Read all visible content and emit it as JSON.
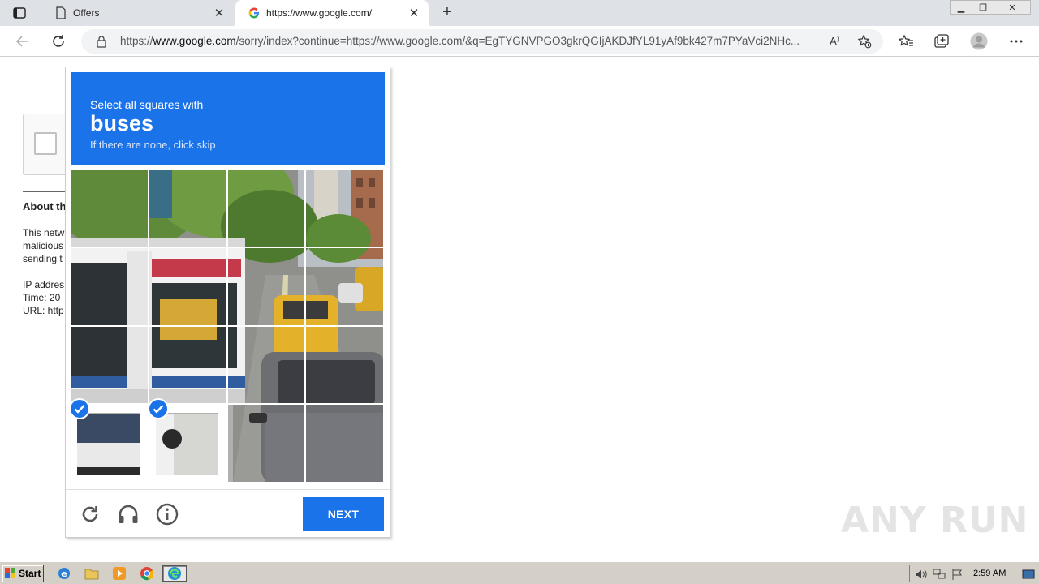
{
  "browser": {
    "tabs": [
      {
        "label": "Offers",
        "icon": "page-icon",
        "active": false
      },
      {
        "label": "https://www.google.com/",
        "icon": "google-icon",
        "active": true
      }
    ],
    "address": {
      "prefix": "https://",
      "host": "www.google.com",
      "path": "/sorry/index?continue=https://www.google.com/&q=EgTYGNVPGO3gkrQGIjAKDJfYL91yAf9bk427m7PYaVci2NHc..."
    }
  },
  "page": {
    "about_heading": "About th",
    "about_lines": [
      "This netw",
      "malicious",
      "sending t"
    ],
    "info_lines": [
      "IP addres",
      "Time: 20",
      "URL: http"
    ]
  },
  "captcha": {
    "instruction": "Select all squares with",
    "target": "buses",
    "hint": "If there are none, click skip",
    "next_label": "NEXT",
    "colors": {
      "accent": "#1a73e8"
    },
    "tiles": [
      {
        "row": 0,
        "col": 0,
        "selected": false
      },
      {
        "row": 0,
        "col": 1,
        "selected": false
      },
      {
        "row": 0,
        "col": 2,
        "selected": false
      },
      {
        "row": 0,
        "col": 3,
        "selected": false
      },
      {
        "row": 1,
        "col": 0,
        "selected": false
      },
      {
        "row": 1,
        "col": 1,
        "selected": false
      },
      {
        "row": 1,
        "col": 2,
        "selected": false
      },
      {
        "row": 1,
        "col": 3,
        "selected": false
      },
      {
        "row": 2,
        "col": 0,
        "selected": false
      },
      {
        "row": 2,
        "col": 1,
        "selected": false
      },
      {
        "row": 2,
        "col": 2,
        "selected": false
      },
      {
        "row": 2,
        "col": 3,
        "selected": false
      },
      {
        "row": 3,
        "col": 0,
        "selected": true
      },
      {
        "row": 3,
        "col": 1,
        "selected": true
      },
      {
        "row": 3,
        "col": 2,
        "selected": false
      },
      {
        "row": 3,
        "col": 3,
        "selected": false
      }
    ]
  },
  "watermark": "ANY RUN",
  "taskbar": {
    "start_label": "Start",
    "clock": "2:59 AM"
  }
}
